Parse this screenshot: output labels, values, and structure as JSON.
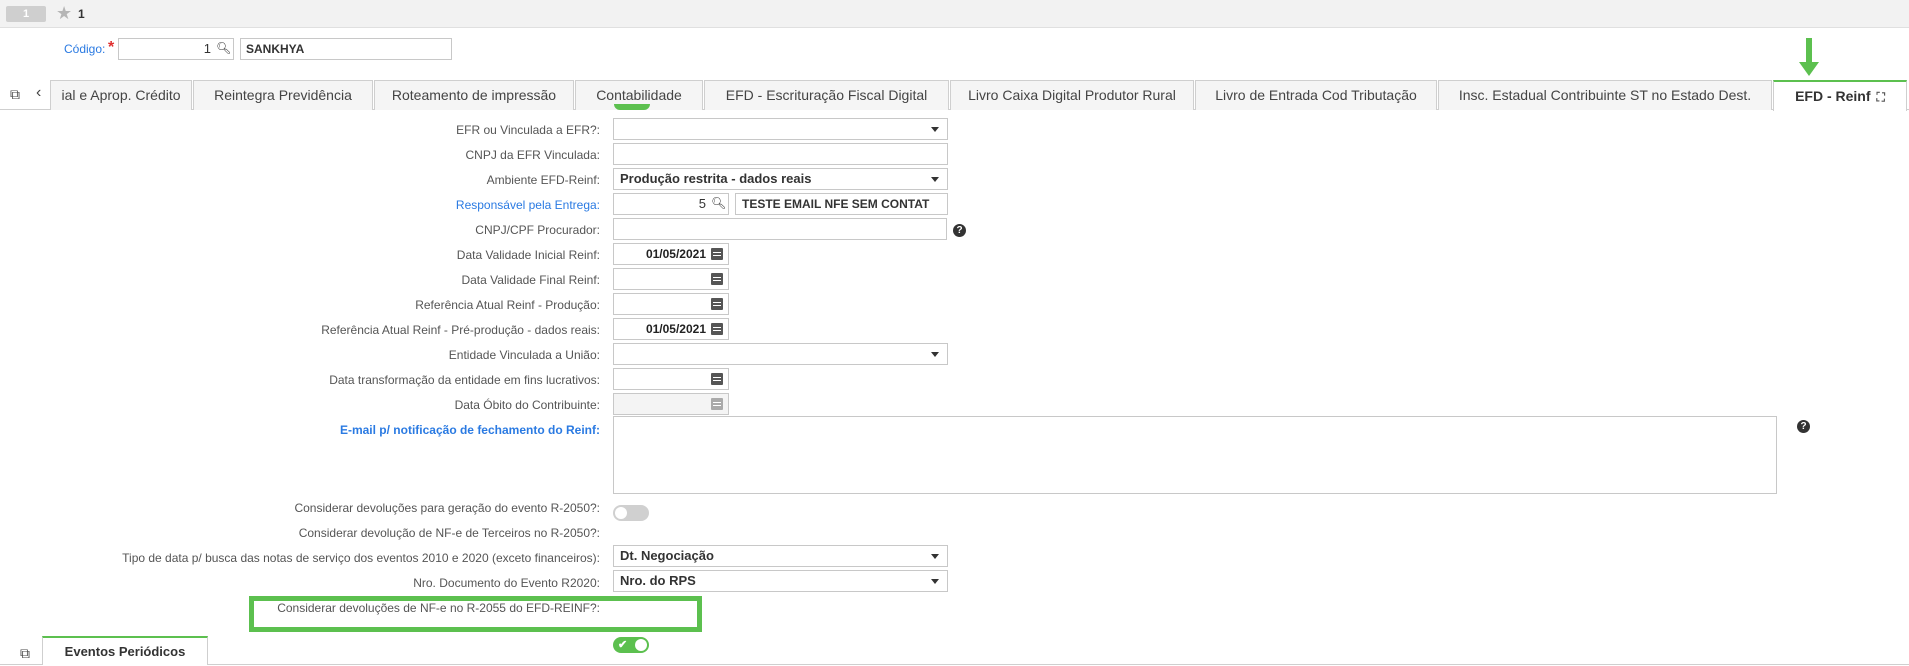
{
  "top": {
    "record_badge": "1",
    "record_count": "1"
  },
  "codigo": {
    "label": "Código:",
    "value": "1",
    "name": "SANKHYA"
  },
  "tabs": [
    {
      "label": "ial e Aprop. Crédito"
    },
    {
      "label": "Reintegra Previdência"
    },
    {
      "label": "Roteamento de impressão"
    },
    {
      "label": "Contabilidade"
    },
    {
      "label": "EFD - Escrituração Fiscal Digital"
    },
    {
      "label": "Livro Caixa Digital Produtor Rural"
    },
    {
      "label": "Livro de Entrada Cod Tributação"
    },
    {
      "label": "Insc. Estadual Contribuinte ST no Estado Dest."
    },
    {
      "label": "EFD - Reinf"
    }
  ],
  "form": {
    "efr_vinculada": {
      "label": "EFR ou Vinculada a EFR?:",
      "value": ""
    },
    "cnpj_efr": {
      "label": "CNPJ da EFR Vinculada:",
      "value": ""
    },
    "ambiente": {
      "label": "Ambiente EFD-Reinf:",
      "value": "Produção restrita - dados reais"
    },
    "responsavel": {
      "label": "Responsável pela Entrega:",
      "code": "5",
      "name": "TESTE EMAIL NFE SEM CONTAT"
    },
    "cnpj_procurador": {
      "label": "CNPJ/CPF Procurador:",
      "value": ""
    },
    "data_inicial": {
      "label": "Data Validade Inicial Reinf:",
      "value": "01/05/2021"
    },
    "data_final": {
      "label": "Data Validade Final Reinf:",
      "value": ""
    },
    "ref_producao": {
      "label": "Referência Atual Reinf - Produção:",
      "value": ""
    },
    "ref_preproducao": {
      "label": "Referência Atual Reinf - Pré-produção - dados reais:",
      "value": "01/05/2021"
    },
    "entidade_uniao": {
      "label": "Entidade Vinculada a União:",
      "value": ""
    },
    "data_transformacao": {
      "label": "Data transformação da entidade em fins lucrativos:",
      "value": ""
    },
    "data_obito": {
      "label": "Data Óbito do Contribuinte:",
      "value": ""
    },
    "email": {
      "label": "E-mail p/ notificação de fechamento do Reinf:",
      "value": ""
    },
    "devol_r2050": {
      "label": "Considerar devoluções para geração do evento R-2050?:",
      "on": false
    },
    "devol_terceiros": {
      "label": "Considerar devolução de NF-e de Terceiros no R-2050?:",
      "on": false
    },
    "tipo_data": {
      "label": "Tipo de data p/ busca das notas de serviço dos eventos 2010 e 2020 (exceto financeiros):",
      "value": "Dt. Negociação"
    },
    "nro_documento": {
      "label": "Nro. Documento do Evento R2020:",
      "value": "Nro. do RPS"
    },
    "devol_r2055": {
      "label": "Considerar devoluções de NF-e no R-2055 do EFD-REINF?:",
      "on": true
    }
  },
  "bottom_tabs": [
    {
      "label": "Eventos Periódicos"
    }
  ],
  "colors": {
    "accent_green": "#5cc04f",
    "link_blue": "#2a7ae2"
  }
}
